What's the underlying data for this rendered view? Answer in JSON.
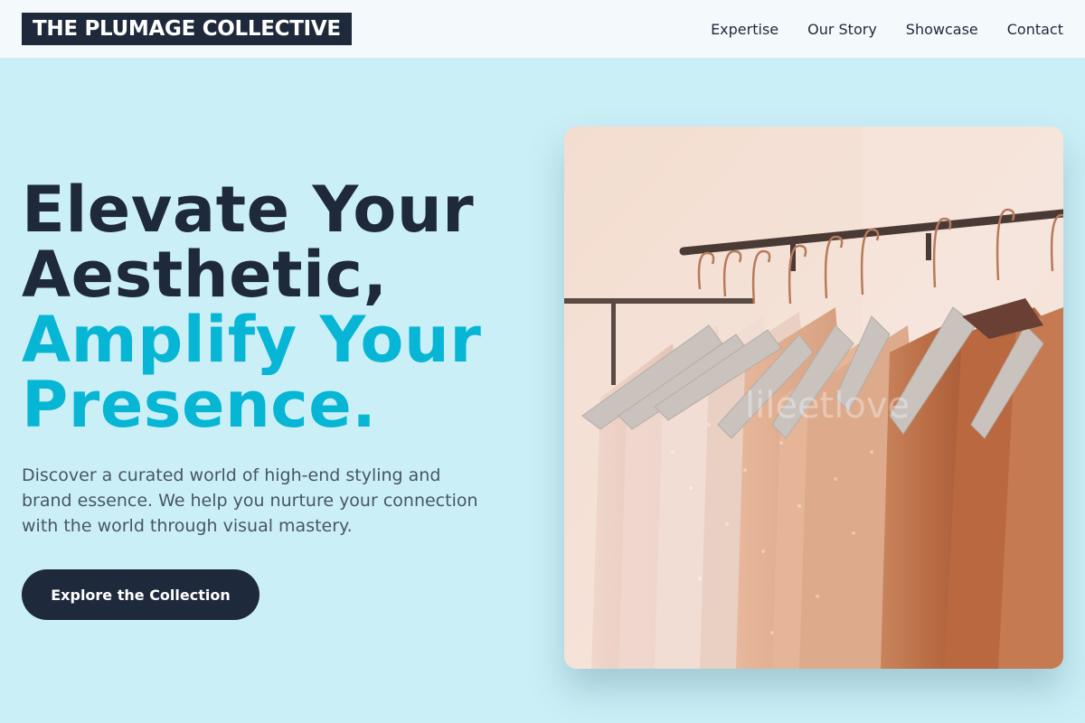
{
  "brand": {
    "name": "THE PLUMAGE COLLECTIVE"
  },
  "nav": {
    "items": [
      {
        "label": "Expertise"
      },
      {
        "label": "Our Story"
      },
      {
        "label": "Showcase"
      },
      {
        "label": "Contact"
      }
    ]
  },
  "hero": {
    "headline_line1": "Elevate Your",
    "headline_line2": "Aesthetic,",
    "headline_accent_line1": "Amplify Your",
    "headline_accent_line2": "Presence.",
    "description": "Discover a curated world of high-end styling and brand essence. We help you nurture your connection with the world through visual mastery.",
    "cta_label": "Explore the Collection",
    "image_watermark": "lileetlove"
  },
  "colors": {
    "background": "#cbeff7",
    "header_background": "#f4f9fc",
    "dark": "#1e293b",
    "accent": "#06b6d4",
    "body_text": "#475569"
  }
}
